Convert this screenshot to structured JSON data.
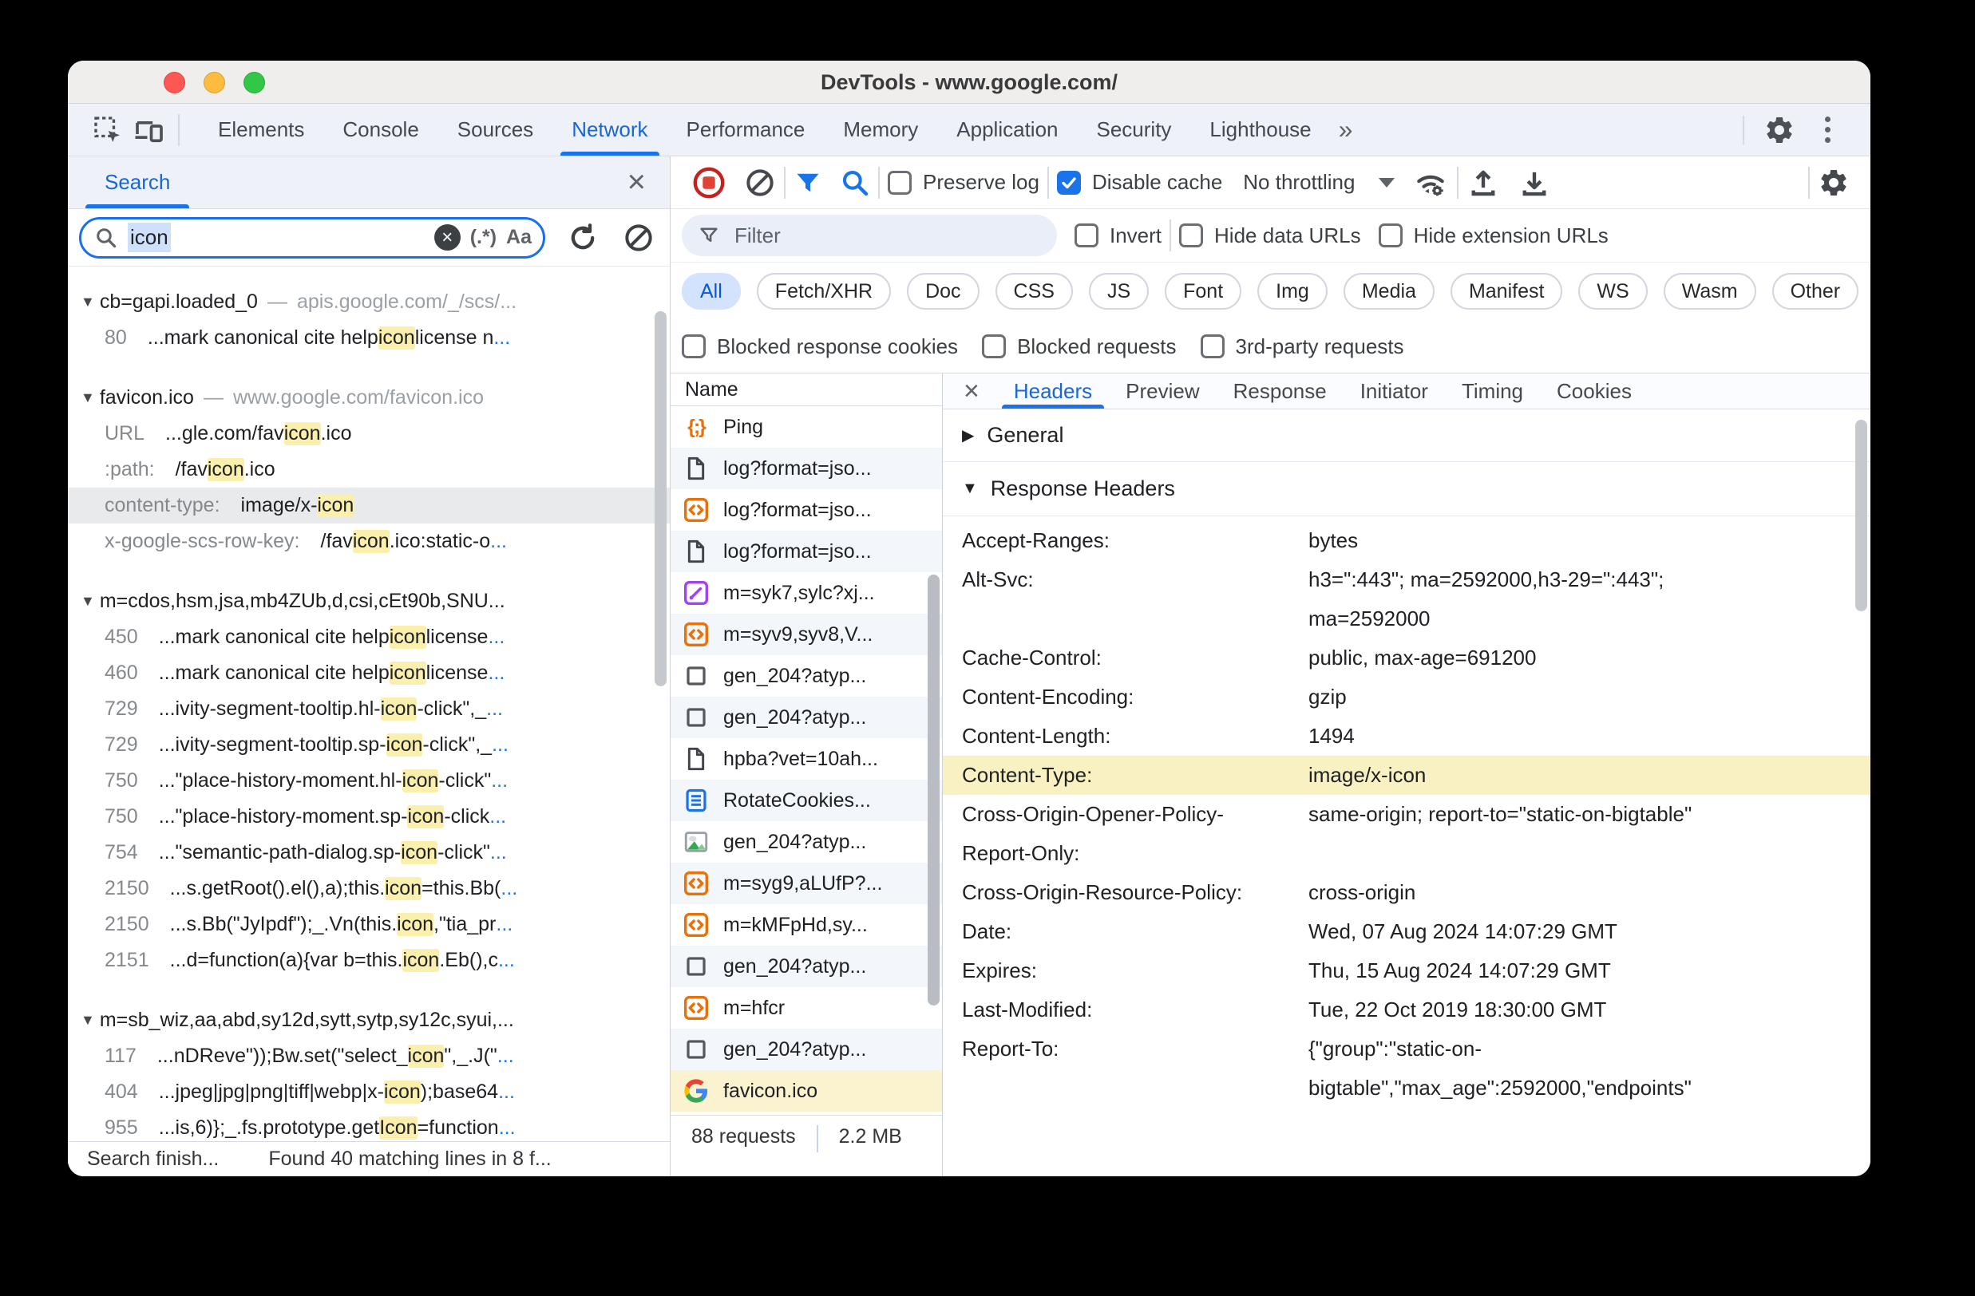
{
  "window": {
    "title": "DevTools - www.google.com/"
  },
  "glyphs": {
    "close": "×",
    "overflow": "»",
    "collapsed": "▶",
    "expanded": "▼",
    "fetch": "{;}"
  },
  "main_tabs": {
    "items": [
      {
        "label": "Elements",
        "active": false
      },
      {
        "label": "Console",
        "active": false
      },
      {
        "label": "Sources",
        "active": false
      },
      {
        "label": "Network",
        "active": true
      },
      {
        "label": "Performance",
        "active": false
      },
      {
        "label": "Memory",
        "active": false
      },
      {
        "label": "Application",
        "active": false
      },
      {
        "label": "Security",
        "active": false
      },
      {
        "label": "Lighthouse",
        "active": false
      }
    ]
  },
  "search_panel": {
    "tab_label": "Search",
    "query": "icon",
    "regex_label": "(.*)",
    "case_label": "Aa",
    "status_left": "Search finish...",
    "status_right": "Found 40 matching lines in 8 f...",
    "results": [
      {
        "name": "cb=gapi.loaded_0",
        "url": "apis.google.com/_/scs/...",
        "lines": [
          {
            "num": "80",
            "segs": [
              {
                "t": "...mark canonical cite help "
              },
              {
                "t": "icon",
                "hl": true
              },
              {
                "t": " license n"
              },
              {
                "t": "...",
                "blue": true
              }
            ]
          }
        ]
      },
      {
        "name": "favicon.ico",
        "url": "www.google.com/favicon.ico",
        "lines": [
          {
            "num": "URL",
            "segs": [
              {
                "t": "...gle.com/fav"
              },
              {
                "t": "icon",
                "hl": true
              },
              {
                "t": ".ico"
              }
            ]
          },
          {
            "num": ":path:",
            "segs": [
              {
                "t": "/fav"
              },
              {
                "t": "icon",
                "hl": true
              },
              {
                "t": ".ico"
              }
            ]
          },
          {
            "num": "content-type:",
            "selected": true,
            "segs": [
              {
                "t": "image/x-"
              },
              {
                "t": "icon",
                "hl": true
              }
            ]
          },
          {
            "num": "x-google-scs-row-key:",
            "segs": [
              {
                "t": "/fav"
              },
              {
                "t": "icon",
                "hl": true
              },
              {
                "t": ".ico:static-o"
              },
              {
                "t": "...",
                "blue": true
              }
            ]
          }
        ]
      },
      {
        "name": "m=cdos,hsm,jsa,mb4ZUb,d,csi,cEt90b,SNU...",
        "url": "",
        "lines": [
          {
            "num": "450",
            "segs": [
              {
                "t": "...mark canonical cite help "
              },
              {
                "t": "icon",
                "hl": true
              },
              {
                "t": " license "
              },
              {
                "t": "...",
                "blue": true
              }
            ]
          },
          {
            "num": "460",
            "segs": [
              {
                "t": "...mark canonical cite help "
              },
              {
                "t": "icon",
                "hl": true
              },
              {
                "t": " license "
              },
              {
                "t": "...",
                "blue": true
              }
            ]
          },
          {
            "num": "729",
            "segs": [
              {
                "t": "...ivity-segment-tooltip.hl-"
              },
              {
                "t": "icon",
                "hl": true
              },
              {
                "t": "-click\",_"
              },
              {
                "t": "...",
                "blue": true
              }
            ]
          },
          {
            "num": "729",
            "segs": [
              {
                "t": "...ivity-segment-tooltip.sp-"
              },
              {
                "t": "icon",
                "hl": true
              },
              {
                "t": "-click\",_"
              },
              {
                "t": "...",
                "blue": true
              }
            ]
          },
          {
            "num": "750",
            "segs": [
              {
                "t": "...\"place-history-moment.hl-"
              },
              {
                "t": "icon",
                "hl": true
              },
              {
                "t": "-click\""
              },
              {
                "t": "...",
                "blue": true
              }
            ]
          },
          {
            "num": "750",
            "segs": [
              {
                "t": "...\"place-history-moment.sp-"
              },
              {
                "t": "icon",
                "hl": true
              },
              {
                "t": "-click"
              },
              {
                "t": "...",
                "blue": true
              }
            ]
          },
          {
            "num": "754",
            "segs": [
              {
                "t": "...\"semantic-path-dialog.sp-"
              },
              {
                "t": "icon",
                "hl": true
              },
              {
                "t": "-click\""
              },
              {
                "t": "...",
                "blue": true
              }
            ]
          },
          {
            "num": "2150",
            "segs": [
              {
                "t": "...s.getRoot().el(),a);this."
              },
              {
                "t": "icon",
                "hl": true
              },
              {
                "t": "=this.Bb("
              },
              {
                "t": "...",
                "blue": true
              }
            ]
          },
          {
            "num": "2150",
            "segs": [
              {
                "t": "...s.Bb(\"JyIpdf\");_.Vn(this."
              },
              {
                "t": "icon",
                "hl": true
              },
              {
                "t": ",\"tia_pr"
              },
              {
                "t": "...",
                "blue": true
              }
            ]
          },
          {
            "num": "2151",
            "segs": [
              {
                "t": "...d=function(a){var b=this."
              },
              {
                "t": "icon",
                "hl": true
              },
              {
                "t": ".Eb(),c"
              },
              {
                "t": "...",
                "blue": true
              }
            ]
          }
        ]
      },
      {
        "name": "m=sb_wiz,aa,abd,sy12d,sytt,sytp,sy12c,syui,...",
        "url": "",
        "lines": [
          {
            "num": "117",
            "segs": [
              {
                "t": "...nDReve\"));Bw.set(\"select_"
              },
              {
                "t": "icon",
                "hl": true
              },
              {
                "t": "\",_.J(\""
              },
              {
                "t": "...",
                "blue": true
              }
            ]
          },
          {
            "num": "404",
            "segs": [
              {
                "t": "...jpeg|jpg|png|tiff|webp|x-"
              },
              {
                "t": "icon",
                "hl": true
              },
              {
                "t": ");base64"
              },
              {
                "t": "...",
                "blue": true
              }
            ]
          },
          {
            "num": "955",
            "segs": [
              {
                "t": "...is,6)};_.fs.prototype.get"
              },
              {
                "t": "Icon",
                "hl": true
              },
              {
                "t": "=function"
              },
              {
                "t": "...",
                "blue": true
              }
            ]
          }
        ]
      }
    ]
  },
  "network_toolbar": {
    "preserve_log": {
      "label": "Preserve log",
      "checked": false
    },
    "disable_cache": {
      "label": "Disable cache",
      "checked": true
    },
    "throttling": "No throttling"
  },
  "filter_bar": {
    "placeholder": "Filter",
    "invert": {
      "label": "Invert",
      "checked": false
    },
    "hide_data": {
      "label": "Hide data URLs",
      "checked": false
    },
    "hide_ext": {
      "label": "Hide extension URLs",
      "checked": false
    }
  },
  "type_chips": [
    {
      "label": "All",
      "active": true
    },
    {
      "label": "Fetch/XHR",
      "active": false
    },
    {
      "label": "Doc",
      "active": false
    },
    {
      "label": "CSS",
      "active": false
    },
    {
      "label": "JS",
      "active": false
    },
    {
      "label": "Font",
      "active": false
    },
    {
      "label": "Img",
      "active": false
    },
    {
      "label": "Media",
      "active": false
    },
    {
      "label": "Manifest",
      "active": false
    },
    {
      "label": "WS",
      "active": false
    },
    {
      "label": "Wasm",
      "active": false
    },
    {
      "label": "Other",
      "active": false
    }
  ],
  "blocked_row": [
    {
      "label": "Blocked response cookies",
      "checked": false
    },
    {
      "label": "Blocked requests",
      "checked": false
    },
    {
      "label": "3rd-party requests",
      "checked": false
    }
  ],
  "request_list": {
    "column": "Name",
    "rows": [
      {
        "type": "fetch",
        "name": "Ping"
      },
      {
        "type": "doc",
        "name": "log?format=jso..."
      },
      {
        "type": "script",
        "name": "log?format=jso..."
      },
      {
        "type": "doc",
        "name": "log?format=jso..."
      },
      {
        "type": "css",
        "name": "m=syk7,sylc?xj..."
      },
      {
        "type": "script",
        "name": "m=syv9,syv8,V..."
      },
      {
        "type": "other",
        "name": "gen_204?atyp..."
      },
      {
        "type": "other",
        "name": "gen_204?atyp..."
      },
      {
        "type": "doc",
        "name": "hpba?vet=10ah..."
      },
      {
        "type": "docblue",
        "name": "RotateCookies..."
      },
      {
        "type": "img",
        "name": "gen_204?atyp..."
      },
      {
        "type": "script",
        "name": "m=syg9,aLUfP?..."
      },
      {
        "type": "script",
        "name": "m=kMFpHd,sy..."
      },
      {
        "type": "other",
        "name": "gen_204?atyp..."
      },
      {
        "type": "script",
        "name": "m=hfcr"
      },
      {
        "type": "other",
        "name": "gen_204?atyp..."
      },
      {
        "type": "favicon",
        "name": "favicon.ico",
        "selected": true
      }
    ],
    "status": {
      "requests": "88 requests",
      "size": "2.2 MB"
    }
  },
  "details": {
    "tabs": [
      {
        "label": "Headers",
        "active": true
      },
      {
        "label": "Preview",
        "active": false
      },
      {
        "label": "Response",
        "active": false
      },
      {
        "label": "Initiator",
        "active": false
      },
      {
        "label": "Timing",
        "active": false
      },
      {
        "label": "Cookies",
        "active": false
      }
    ],
    "sections": {
      "general": "General",
      "response_headers": "Response Headers"
    },
    "headers": [
      {
        "k": "Accept-Ranges:",
        "v": "bytes"
      },
      {
        "k": "Alt-Svc:",
        "v": "h3=\":443\"; ma=2592000,h3-29=\":443\"; ma=2592000"
      },
      {
        "k": "Cache-Control:",
        "v": "public, max-age=691200"
      },
      {
        "k": "Content-Encoding:",
        "v": "gzip"
      },
      {
        "k": "Content-Length:",
        "v": "1494"
      },
      {
        "k": "Content-Type:",
        "v": "image/x-icon",
        "hl": true
      },
      {
        "k": "Cross-Origin-Opener-Policy-Report-Only:",
        "v": "same-origin; report-to=\"static-on-bigtable\""
      },
      {
        "k": "Cross-Origin-Resource-Policy:",
        "v": "cross-origin"
      },
      {
        "k": "Date:",
        "v": "Wed, 07 Aug 2024 14:07:29 GMT"
      },
      {
        "k": "Expires:",
        "v": "Thu, 15 Aug 2024 14:07:29 GMT"
      },
      {
        "k": "Last-Modified:",
        "v": "Tue, 22 Oct 2019 18:30:00 GMT"
      },
      {
        "k": "Report-To:",
        "v": "{\"group\":\"static-on-bigtable\",\"max_age\":2592000,\"endpoints\""
      }
    ]
  }
}
